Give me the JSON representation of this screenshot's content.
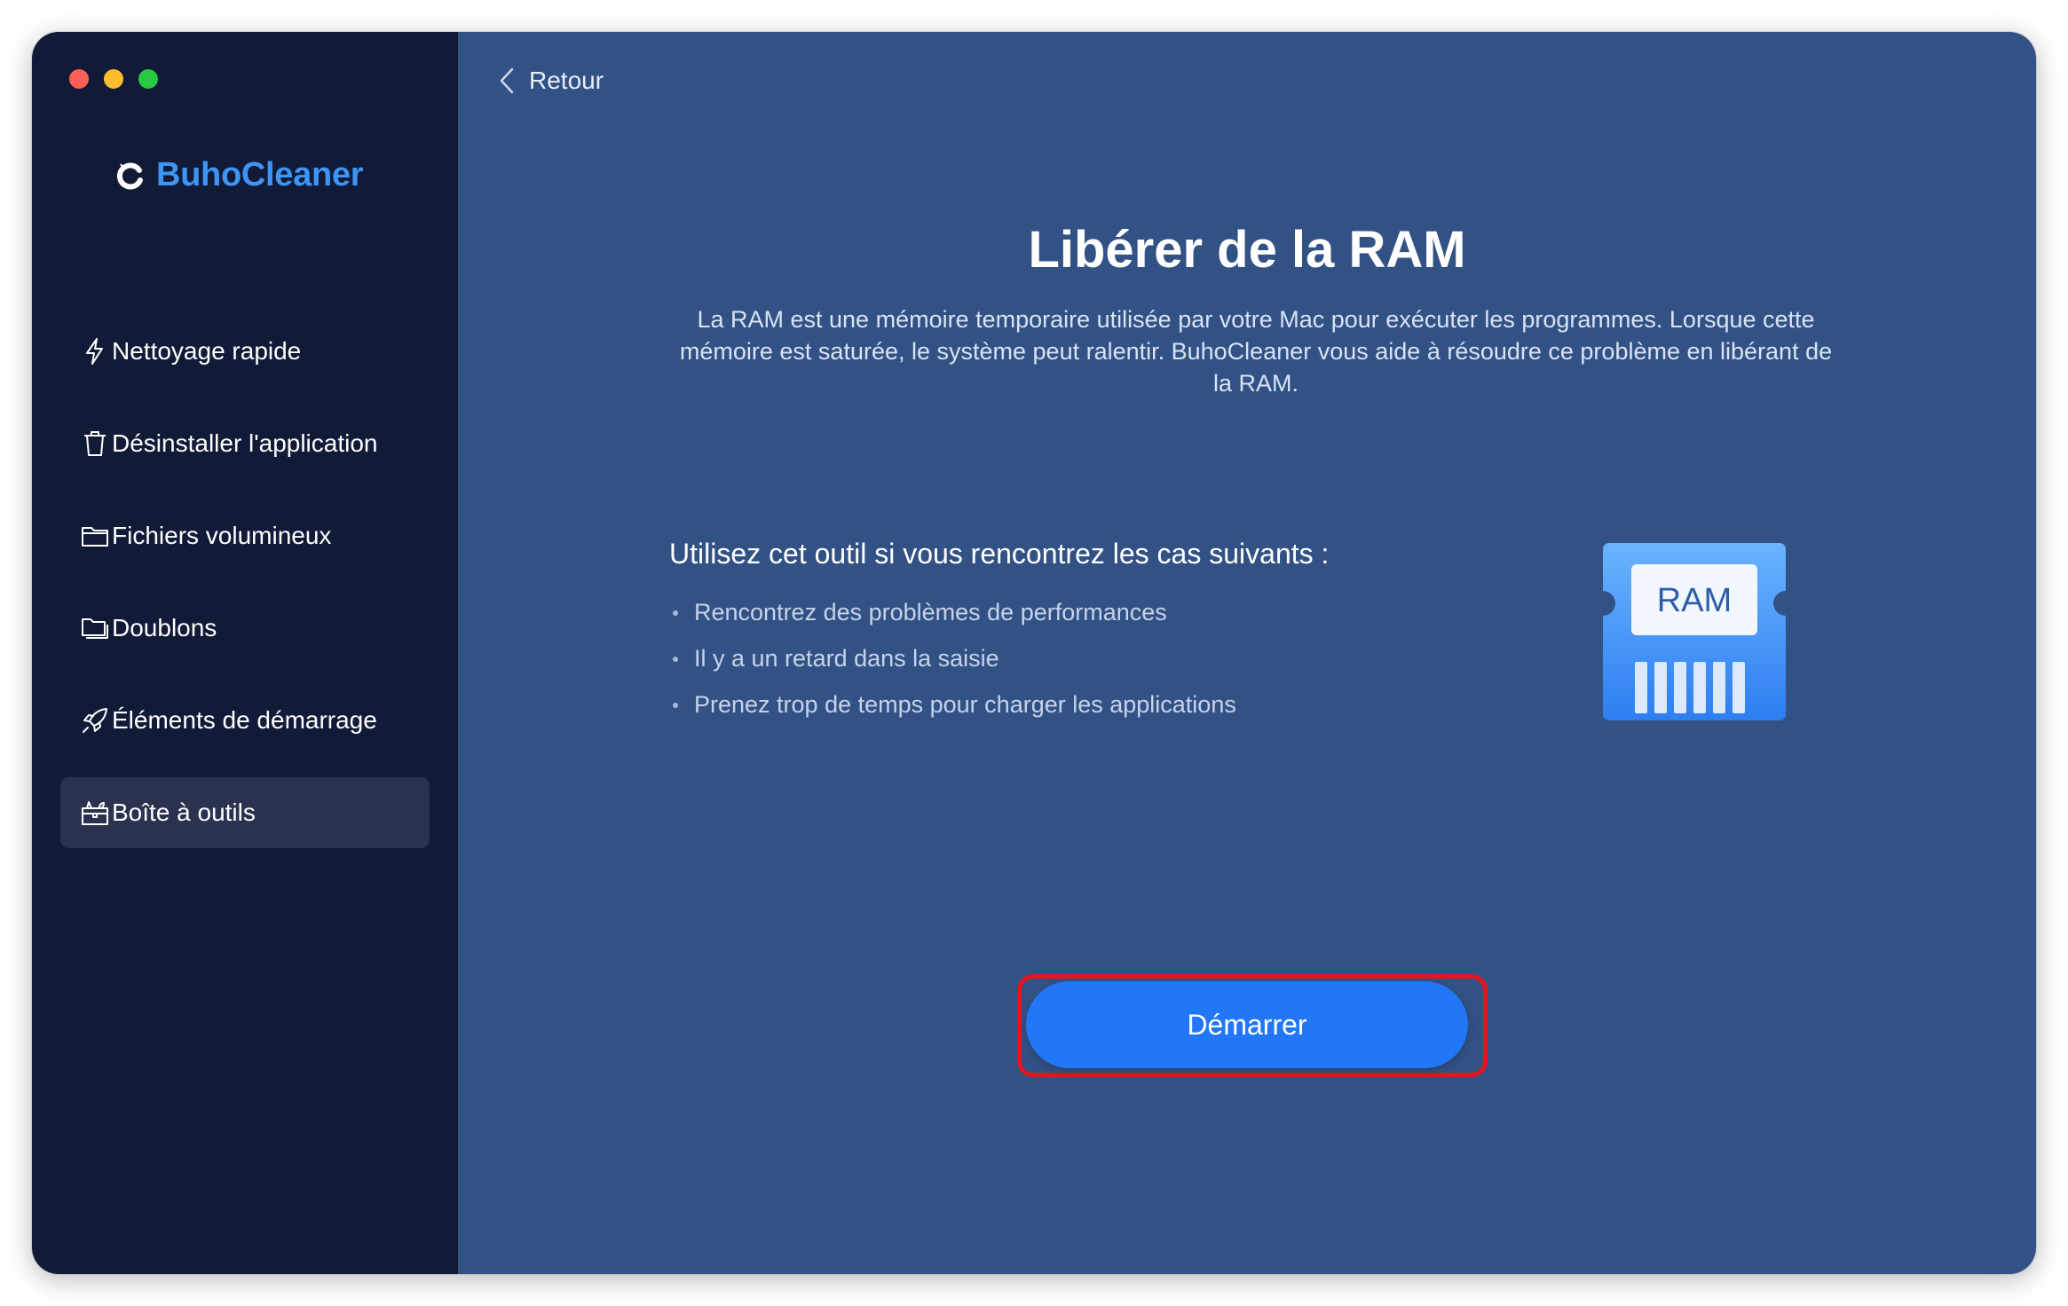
{
  "app": {
    "brand_name": "BuhoCleaner",
    "accent": "#3d95f5"
  },
  "sidebar": {
    "items": [
      {
        "label": "Nettoyage rapide",
        "icon": "lightning-icon",
        "active": false
      },
      {
        "label": "Désinstaller l'application",
        "icon": "trash-icon",
        "active": false
      },
      {
        "label": "Fichiers volumineux",
        "icon": "folder-icon",
        "active": false
      },
      {
        "label": "Doublons",
        "icon": "duplicate-folder-icon",
        "active": false
      },
      {
        "label": "Éléments de démarrage",
        "icon": "rocket-icon",
        "active": false
      },
      {
        "label": "Boîte à outils",
        "icon": "toolbox-icon",
        "active": true
      }
    ]
  },
  "header": {
    "back_label": "Retour"
  },
  "main": {
    "title": "Libérer de la RAM",
    "description": "La RAM est une mémoire temporaire utilisée par votre Mac pour exécuter les programmes. Lorsque cette mémoire est saturée, le système peut ralentir. BuhoCleaner vous aide à résoudre ce problème en libérant de la RAM.",
    "usecase_title": "Utilisez cet outil si vous rencontrez les cas suivants :",
    "usecases": [
      "Rencontrez des problèmes de performances",
      "Il y a un retard dans la saisie",
      "Prenez trop de temps pour charger les applications"
    ],
    "illustration_label": "RAM",
    "start_label": "Démarrer",
    "start_color": "#2177f5",
    "highlight_color": "#e4151c"
  }
}
